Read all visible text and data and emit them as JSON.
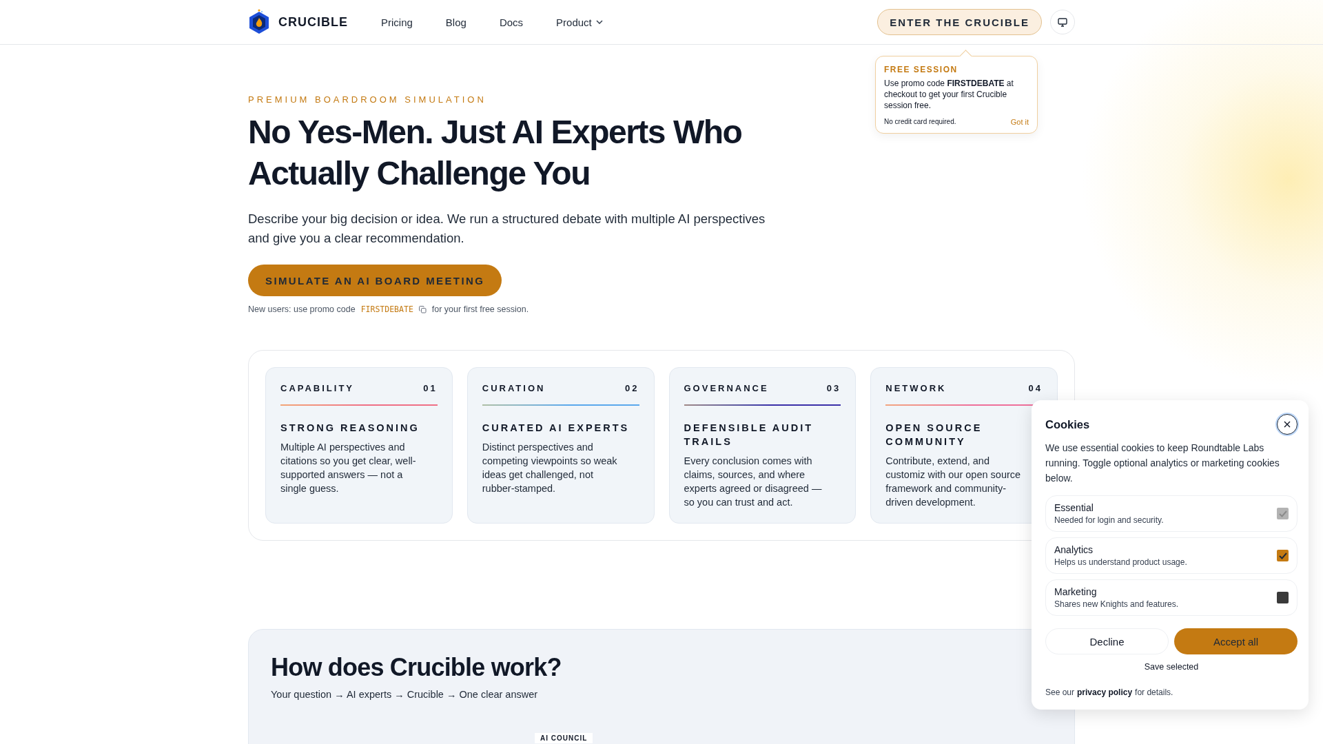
{
  "header": {
    "logo_text": "CRUCIBLE",
    "nav": [
      {
        "label": "Pricing",
        "kind": "link"
      },
      {
        "label": "Blog",
        "kind": "link"
      },
      {
        "label": "Docs",
        "kind": "link"
      },
      {
        "label": "Product",
        "kind": "dropdown"
      }
    ],
    "cta": "ENTER THE CRUCIBLE"
  },
  "promo_popover": {
    "title": "FREE SESSION",
    "body": "Use promo code **FIRSTDEBATE** at checkout to get your first Crucible session free.",
    "note": "No credit card required.",
    "dismiss": "Got it"
  },
  "hero": {
    "eyebrow": "PREMIUM BOARDROOM SIMULATION",
    "title": "No Yes-Men. Just AI Experts Who Actually Challenge You",
    "description": "Describe your big decision or idea. We run a structured debate with multiple AI perspectives and give you a clear recommendation.",
    "cta": "SIMULATE AN AI BOARD MEETING",
    "promo_note": {
      "before": "New users: use promo code",
      "code": "FIRSTDEBATE",
      "after": "for your first free session."
    }
  },
  "features": [
    {
      "category": "CAPABILITY",
      "number": "01",
      "title": "STRONG REASONING",
      "description": "Multiple AI perspectives and citations so you get clear, well-supported answers — not a single guess.",
      "color": "#ef6f86"
    },
    {
      "category": "CURATION",
      "number": "02",
      "title": "CURATED AI EXPERTS",
      "description": "Distinct perspectives and competing viewpoints so weak ideas get challenged, not rubber-stamped.",
      "color": "#5aa8ec"
    },
    {
      "category": "GOVERNANCE",
      "number": "03",
      "title": "DEFENSIBLE AUDIT TRAILS",
      "description": "Every conclusion comes with claims, sources, and where experts agreed or disagreed — so you can trust and act.",
      "color": "#3a2fa8"
    },
    {
      "category": "NETWORK",
      "number": "04",
      "title": "OPEN SOURCE COMMUNITY",
      "description": "Contribute, extend, and customiz with our open source framework and community-driven development.",
      "color": "#ee6f9a"
    }
  ],
  "how_it_works": {
    "title": "How does Crucible work?",
    "subtitle": "Your question → AI experts → Crucible → One clear answer",
    "badge": "AI COUNCIL"
  },
  "cookies": {
    "title": "Cookies",
    "text": "We use essential cookies to keep Roundtable Labs running. Toggle optional analytics or marketing cookies below.",
    "options": [
      {
        "name": "Essential",
        "description": "Needed for login and security.",
        "checked": true,
        "disabled": true
      },
      {
        "name": "Analytics",
        "description": "Helps us understand product usage.",
        "checked": true,
        "disabled": false
      },
      {
        "name": "Marketing",
        "description": "Shares new Knights and features.",
        "checked": false,
        "disabled": false
      }
    ],
    "decline": "Decline",
    "accept": "Accept all",
    "save": "Save selected",
    "footer": {
      "before": "See our",
      "link": "privacy policy",
      "after": "for details."
    }
  }
}
